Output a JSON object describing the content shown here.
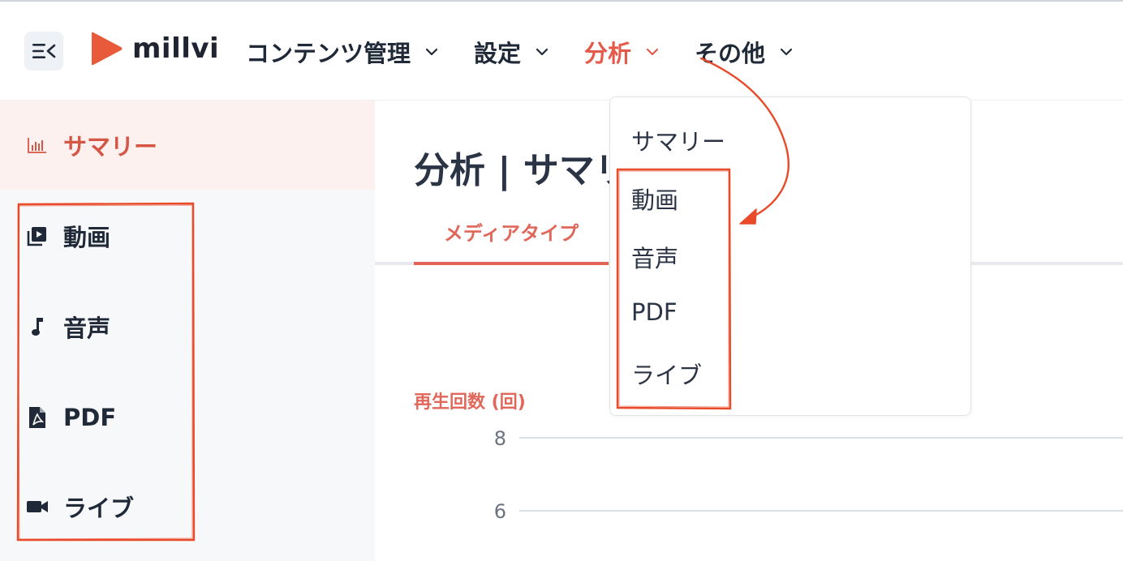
{
  "header": {
    "logo_text": "millvi",
    "nav": [
      {
        "label": "コンテンツ管理"
      },
      {
        "label": "設定"
      },
      {
        "label": "分析"
      },
      {
        "label": "その他"
      }
    ]
  },
  "sidebar": {
    "items": [
      {
        "label": "サマリー",
        "icon": "bar-chart-icon"
      },
      {
        "label": "動画",
        "icon": "video-library-icon"
      },
      {
        "label": "音声",
        "icon": "music-note-icon"
      },
      {
        "label": "PDF",
        "icon": "pdf-file-icon"
      },
      {
        "label": "ライブ",
        "icon": "video-camera-icon"
      }
    ]
  },
  "main": {
    "title": "分析 | サマリー",
    "tabs": [
      {
        "label": "メディアタイプ"
      }
    ],
    "chart_label": "再生回数 (回)"
  },
  "dropdown": {
    "items": [
      {
        "label": "サマリー"
      },
      {
        "label": "動画"
      },
      {
        "label": "音声"
      },
      {
        "label": "PDF"
      },
      {
        "label": "ライブ"
      }
    ]
  },
  "colors": {
    "accent": "#e35a4a",
    "annotation": "#e84a2a",
    "logo": "#e85a3a"
  },
  "chart_data": {
    "type": "line",
    "ylabel": "再生回数 (回)",
    "y_ticks": [
      8,
      6
    ],
    "series": []
  }
}
